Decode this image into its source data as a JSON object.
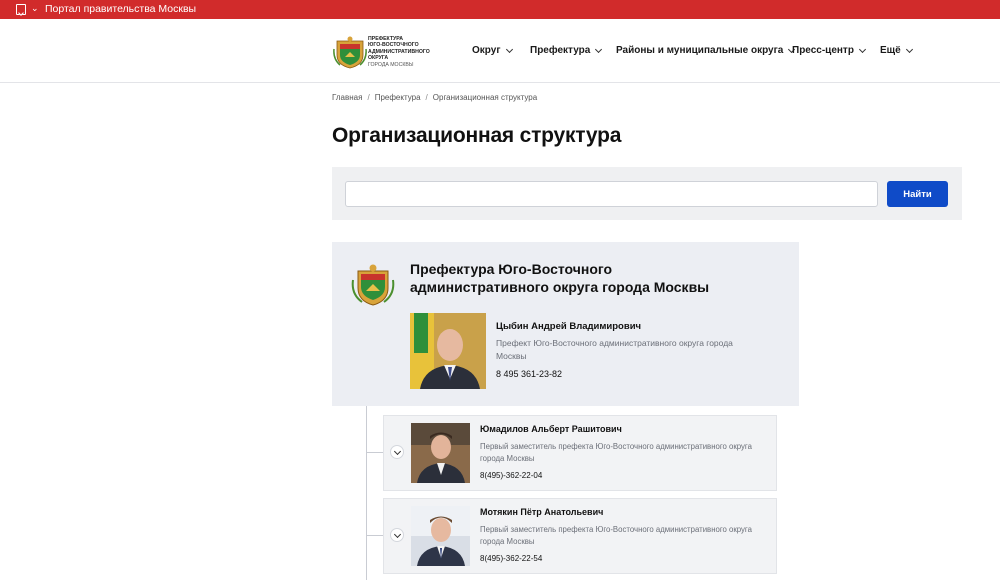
{
  "topbar": {
    "portal_label": "Портал правительства Москвы"
  },
  "header": {
    "logo_lines": [
      "Префектура",
      "Юго-Восточного",
      "административного округа"
    ],
    "logo_subline": "города Москвы",
    "nav": [
      {
        "label": "Округ"
      },
      {
        "label": "Префектура"
      },
      {
        "label": "Районы и муниципальные округа"
      },
      {
        "label": "Пресс-центр"
      },
      {
        "label": "Ещё"
      }
    ]
  },
  "breadcrumb": [
    "Главная",
    "Префектура",
    "Организационная структура"
  ],
  "page_title": "Организационная структура",
  "search": {
    "value": "",
    "button_label": "Найти"
  },
  "org": {
    "name": "Префектура Юго-Восточного административного округа города Москвы",
    "head": {
      "name": "Цыбин Андрей Владимирович",
      "role": "Префект Юго-Восточного административного округа города Москвы",
      "phone": "8 495 361-23-82"
    }
  },
  "staff": [
    {
      "name": "Юмадилов Альберт Рашитович",
      "role": "Первый заместитель префекта Юго-Восточного административного округа города Москвы",
      "phone": "8(495)-362-22-04"
    },
    {
      "name": "Мотякин Пётр Анатольевич",
      "role": "Первый заместитель префекта Юго-Восточного административного округа города Москвы",
      "phone": "8(495)-362-22-54"
    }
  ],
  "colors": {
    "topbar": "#d12b2b",
    "button": "#0f4bc8",
    "card_bg": "#eceef3"
  },
  "icons": {
    "portal": "book-icon",
    "caret": "chevron-down-icon",
    "expand": "chevron-down-icon"
  }
}
